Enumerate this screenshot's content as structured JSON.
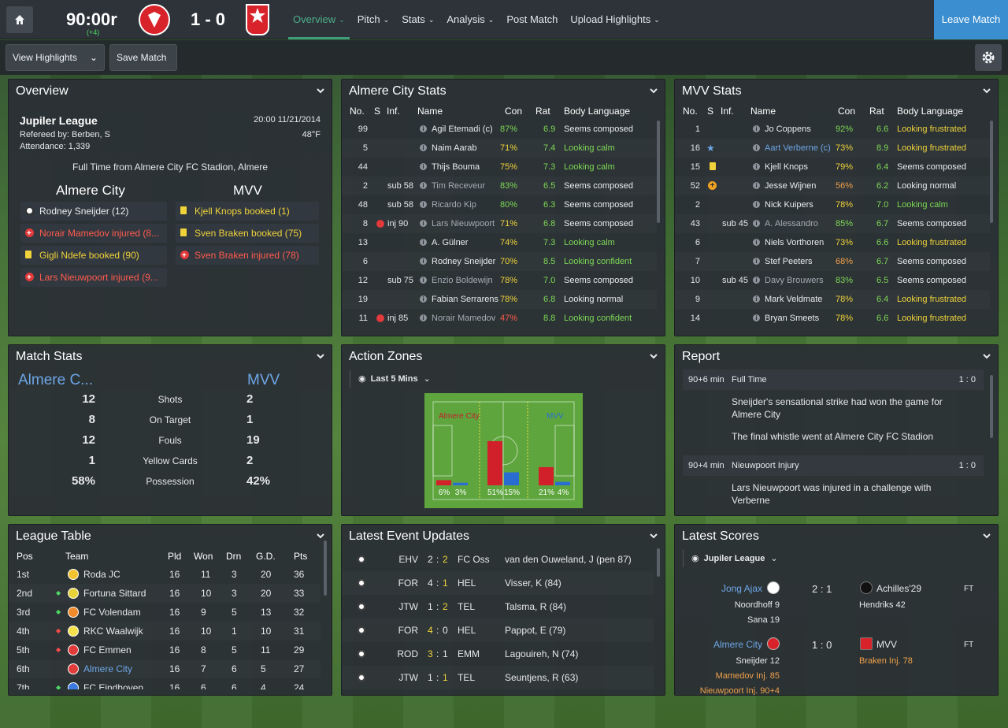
{
  "topbar": {
    "clock": "90:00r",
    "added": "(+4)",
    "score": "1 - 0",
    "nav": [
      {
        "label": "Overview",
        "chev": true,
        "active": true
      },
      {
        "label": "Pitch",
        "chev": true
      },
      {
        "label": "Stats",
        "chev": true
      },
      {
        "label": "Analysis",
        "chev": true
      },
      {
        "label": "Post Match",
        "chev": false
      },
      {
        "label": "Upload Highlights",
        "chev": true
      }
    ],
    "leave": "Leave Match"
  },
  "subbar": {
    "highlights": "View Highlights",
    "save": "Save Match"
  },
  "overview": {
    "title": "Overview",
    "league": "Jupiler League",
    "datetime": "20:00 11/21/2014",
    "referee": "Refereed by: Berben, S",
    "temp": "48°F",
    "attendance": "Attendance: 1,339",
    "fulltime": "Full Time from Almere City FC Stadion, Almere",
    "home": "Almere City",
    "away": "MVV",
    "home_events": [
      {
        "icon": "ball",
        "text": "Rodney Sneijder (12)",
        "color": "white"
      },
      {
        "icon": "injury",
        "text": "Norair Mamedov injured (8...",
        "color": "red"
      },
      {
        "icon": "yellow",
        "text": "Gigli Ndefe booked (90)",
        "color": "yellow"
      },
      {
        "icon": "injury",
        "text": "Lars Nieuwpoort injured (9...",
        "color": "red"
      }
    ],
    "away_events": [
      {
        "icon": "yellow",
        "text": "Kjell Knops booked (1)",
        "color": "yellow"
      },
      {
        "icon": "yellow",
        "text": "Sven Braken booked (75)",
        "color": "yellow"
      },
      {
        "icon": "injury",
        "text": "Sven Braken injured (78)",
        "color": "red"
      }
    ]
  },
  "almere_stats": {
    "title": "Almere City Stats",
    "headers": {
      "no": "No.",
      "s": "S",
      "inf": "Inf.",
      "name": "Name",
      "con": "Con",
      "rat": "Rat",
      "body": "Body Language"
    },
    "rows": [
      {
        "no": "99",
        "sub": "",
        "inj": false,
        "name": "Agil Etemadi (c)",
        "con": "87%",
        "rat": "6.9",
        "body": "Seems composed",
        "bc": "white",
        "sel": false,
        "cc": "green"
      },
      {
        "no": "5",
        "sub": "",
        "inj": false,
        "name": "Naim Aarab",
        "con": "71%",
        "rat": "7.4",
        "body": "Looking calm",
        "bc": "green",
        "cc": "yellow"
      },
      {
        "no": "44",
        "sub": "",
        "inj": false,
        "name": "Thijs Bouma",
        "con": "75%",
        "rat": "7.3",
        "body": "Looking calm",
        "bc": "green",
        "cc": "yellow"
      },
      {
        "no": "2",
        "sub": "sub 58",
        "inj": false,
        "name": "Tim Receveur",
        "con": "83%",
        "rat": "6.5",
        "body": "Seems composed",
        "bc": "white",
        "grey": true,
        "cc": "green"
      },
      {
        "no": "48",
        "sub": "sub 58",
        "inj": false,
        "name": "Ricardo Kip",
        "con": "80%",
        "rat": "6.3",
        "body": "Seems composed",
        "bc": "white",
        "grey": true,
        "cc": "green"
      },
      {
        "no": "8",
        "sub": "inj 90",
        "inj": true,
        "name": "Lars Nieuwpoort",
        "con": "71%",
        "rat": "6.8",
        "body": "Seems composed",
        "bc": "white",
        "grey": true,
        "cc": "yellow"
      },
      {
        "no": "13",
        "sub": "",
        "inj": false,
        "name": "A. Gülner",
        "con": "74%",
        "rat": "7.3",
        "body": "Looking calm",
        "bc": "green",
        "cc": "yellow"
      },
      {
        "no": "6",
        "sub": "",
        "inj": false,
        "name": "Rodney Sneijder",
        "con": "70%",
        "rat": "8.5",
        "body": "Looking confident",
        "bc": "green",
        "cc": "yellow"
      },
      {
        "no": "12",
        "sub": "sub 75",
        "inj": false,
        "name": "Enzio Boldewijn",
        "con": "78%",
        "rat": "7.0",
        "body": "Seems composed",
        "bc": "white",
        "grey": true,
        "cc": "yellow"
      },
      {
        "no": "19",
        "sub": "",
        "inj": false,
        "name": "Fabian Serrarens",
        "con": "78%",
        "rat": "6.8",
        "body": "Looking normal",
        "bc": "white",
        "cc": "yellow"
      },
      {
        "no": "11",
        "sub": "inj 85",
        "inj": true,
        "name": "Norair Mamedov",
        "con": "47%",
        "rat": "8.8",
        "body": "Looking confident",
        "bc": "green",
        "grey": true,
        "cc": "red"
      }
    ]
  },
  "mvv_stats": {
    "title": "MVV Stats",
    "headers": {
      "no": "No.",
      "s": "S",
      "inf": "Inf.",
      "name": "Name",
      "con": "Con",
      "rat": "Rat",
      "body": "Body Language"
    },
    "rows": [
      {
        "no": "1",
        "s": "",
        "inf": "",
        "name": "Jo Coppens",
        "con": "92%",
        "rat": "6.6",
        "body": "Looking frustrated",
        "bc": "yellow",
        "cc": "green"
      },
      {
        "no": "16",
        "s": "star",
        "inf": "",
        "name": "Aart Verberne (c)",
        "con": "73%",
        "rat": "8.9",
        "body": "Looking frustrated",
        "bc": "yellow",
        "blue": true,
        "cc": "yellow"
      },
      {
        "no": "15",
        "s": "yellow",
        "inf": "",
        "name": "Kjell Knops",
        "con": "79%",
        "rat": "6.4",
        "body": "Seems composed",
        "bc": "white",
        "cc": "yellow"
      },
      {
        "no": "52",
        "s": "plus",
        "inf": "",
        "name": "Jesse Wijnen",
        "con": "56%",
        "rat": "6.2",
        "body": "Looking normal",
        "bc": "white",
        "cc": "orange"
      },
      {
        "no": "2",
        "s": "",
        "inf": "",
        "name": "Nick Kuipers",
        "con": "78%",
        "rat": "7.0",
        "body": "Looking calm",
        "bc": "green",
        "cc": "yellow"
      },
      {
        "no": "43",
        "s": "",
        "inf": "sub 45",
        "name": "A. Alessandro",
        "con": "85%",
        "rat": "6.7",
        "body": "Seems composed",
        "bc": "white",
        "grey": true,
        "cc": "green"
      },
      {
        "no": "6",
        "s": "",
        "inf": "",
        "name": "Niels Vorthoren",
        "con": "73%",
        "rat": "6.6",
        "body": "Looking frustrated",
        "bc": "yellow",
        "cc": "yellow"
      },
      {
        "no": "7",
        "s": "",
        "inf": "",
        "name": "Stef Peeters",
        "con": "68%",
        "rat": "6.7",
        "body": "Seems composed",
        "bc": "white",
        "cc": "orange"
      },
      {
        "no": "10",
        "s": "",
        "inf": "sub 45",
        "name": "Davy Brouwers",
        "con": "83%",
        "rat": "6.5",
        "body": "Seems composed",
        "bc": "white",
        "grey": true,
        "cc": "green"
      },
      {
        "no": "9",
        "s": "",
        "inf": "",
        "name": "Mark Veldmate",
        "con": "78%",
        "rat": "6.4",
        "body": "Looking frustrated",
        "bc": "yellow",
        "cc": "yellow"
      },
      {
        "no": "14",
        "s": "",
        "inf": "",
        "name": "Bryan Smeets",
        "con": "78%",
        "rat": "6.6",
        "body": "Looking frustrated",
        "bc": "yellow",
        "cc": "yellow"
      }
    ]
  },
  "match_stats": {
    "title": "Match Stats",
    "home": "Almere C...",
    "away": "MVV",
    "rows": [
      {
        "label": "Shots",
        "h": "12",
        "a": "2"
      },
      {
        "label": "On Target",
        "h": "8",
        "a": "1"
      },
      {
        "label": "Fouls",
        "h": "12",
        "a": "19"
      },
      {
        "label": "Yellow Cards",
        "h": "1",
        "a": "2"
      },
      {
        "label": "Possession",
        "h": "58%",
        "a": "42%"
      }
    ]
  },
  "action_zones": {
    "title": "Action Zones",
    "period": "Last 5 Mins",
    "home": "Almere City",
    "away": "MVV",
    "zones": [
      {
        "h": 6,
        "a": 3,
        "hl": "6%",
        "al": "3%"
      },
      {
        "h": 51,
        "a": 15,
        "hl": "51%",
        "al": "15%"
      },
      {
        "h": 21,
        "a": 4,
        "hl": "21%",
        "al": "4%"
      }
    ]
  },
  "report": {
    "title": "Report",
    "items": [
      {
        "min": "90+6 min",
        "event": "Full Time",
        "score": "1 : 0",
        "texts": [
          "Sneijder's sensational strike had won the game for Almere City",
          "The final whistle went at Almere City FC Stadion"
        ]
      },
      {
        "min": "90+4 min",
        "event": "Nieuwpoort Injury",
        "score": "1 : 0",
        "texts": [
          "Lars Nieuwpoort was injured in a challenge with Verberne"
        ]
      }
    ]
  },
  "league_table": {
    "title": "League Table",
    "headers": {
      "pos": "Pos",
      "team": "Team",
      "pld": "Pld",
      "won": "Won",
      "drn": "Drn",
      "gd": "G.D.",
      "pts": "Pts"
    },
    "rows": [
      {
        "pos": "1st",
        "team": "Roda JC",
        "pld": "16",
        "won": "11",
        "drn": "3",
        "gd": "20",
        "pts": "36",
        "mv": "",
        "c": "#f2c230"
      },
      {
        "pos": "2nd",
        "team": "Fortuna Sittard",
        "pld": "16",
        "won": "10",
        "drn": "3",
        "gd": "20",
        "pts": "33",
        "mv": "up",
        "c": "#e8d23a"
      },
      {
        "pos": "3rd",
        "team": "FC Volendam",
        "pld": "16",
        "won": "9",
        "drn": "5",
        "gd": "13",
        "pts": "32",
        "mv": "up",
        "c": "#f08a2a"
      },
      {
        "pos": "4th",
        "team": "RKC Waalwijk",
        "pld": "16",
        "won": "10",
        "drn": "1",
        "gd": "10",
        "pts": "31",
        "mv": "down",
        "c": "#f5e24a"
      },
      {
        "pos": "5th",
        "team": "FC Emmen",
        "pld": "16",
        "won": "8",
        "drn": "5",
        "gd": "11",
        "pts": "29",
        "mv": "down",
        "c": "#e23b3b"
      },
      {
        "pos": "6th",
        "team": "Almere City",
        "pld": "16",
        "won": "7",
        "drn": "6",
        "gd": "5",
        "pts": "27",
        "mv": "",
        "c": "#e23b3b",
        "hl": true
      },
      {
        "pos": "7th",
        "team": "FC Eindhoven",
        "pld": "16",
        "won": "6",
        "drn": "6",
        "gd": "4",
        "pts": "24",
        "mv": "up",
        "c": "#3b7be2"
      }
    ]
  },
  "latest_updates": {
    "title": "Latest Event Updates",
    "rows": [
      {
        "home": "EHV",
        "hs": "2",
        "as": "2",
        "away": "FC Oss",
        "hc": "white",
        "ac": "yellow",
        "scorer": "van den Ouweland, J (pen 87)"
      },
      {
        "home": "FOR",
        "hs": "4",
        "as": "1",
        "away": "HEL",
        "hc": "white",
        "ac": "yellow",
        "scorer": "Visser, K (84)"
      },
      {
        "home": "JTW",
        "hs": "1",
        "as": "2",
        "away": "TEL",
        "hc": "white",
        "ac": "yellow",
        "scorer": "Talsma, R (84)"
      },
      {
        "home": "FOR",
        "hs": "4",
        "as": "0",
        "away": "HEL",
        "hc": "yellow",
        "ac": "white",
        "scorer": "Pappot, E (79)"
      },
      {
        "home": "ROD",
        "hs": "3",
        "as": "1",
        "away": "EMM",
        "hc": "yellow",
        "ac": "white",
        "scorer": "Lagouireh, N (74)"
      },
      {
        "home": "JTW",
        "hs": "1",
        "as": "1",
        "away": "TEL",
        "hc": "white",
        "ac": "yellow",
        "scorer": "Seuntjens, R (63)"
      }
    ]
  },
  "latest_scores": {
    "title": "Latest Scores",
    "league": "Jupiler League",
    "matches": [
      {
        "home": "Jong Ajax",
        "away": "Achilles'29",
        "score": "2 : 1",
        "status": "FT",
        "home_scorers": [
          "Noordhoff 9",
          "Sana 19"
        ],
        "away_scorers": [
          "Hendriks 42"
        ]
      },
      {
        "home": "Almere City",
        "away": "MVV",
        "score": "1 : 0",
        "status": "FT",
        "home_scorers": [
          "Sneijder 12",
          "Mamedov Inj. 85",
          "Nieuwpoort Inj. 90+4"
        ],
        "away_scorers": [
          "Braken Inj. 78"
        ]
      }
    ]
  },
  "colors": {
    "accent": "#3e9e7c",
    "leave": "#3b8ed0",
    "home_bar": "#d2202a",
    "away_bar": "#2a6dd2"
  }
}
